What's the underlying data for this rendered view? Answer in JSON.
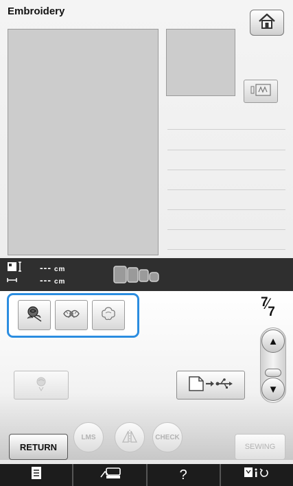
{
  "header": {
    "title": "Embroidery",
    "home_icon": "home-icon"
  },
  "preview": {
    "thumb_mode_icon": "thumbnail-toggle-icon"
  },
  "dimensions": {
    "height_value": "---",
    "height_unit": "cm",
    "width_value": "---",
    "width_unit": "cm",
    "size_icon": "pattern-size-icon",
    "hoop_icon": "embroidery-frame-icon"
  },
  "patterns": {
    "items": [
      {
        "icon": "rose-pattern-icon"
      },
      {
        "icon": "leaf-flower-pattern-icon"
      },
      {
        "icon": "flower-outline-pattern-icon"
      }
    ]
  },
  "pager": {
    "current": "7",
    "total": "7",
    "up_label": "▲",
    "down_label": "▼"
  },
  "actions": {
    "usb_icon": "usb-transfer-icon",
    "preview_icon": "pattern-preview-icon"
  },
  "footer": {
    "return_label": "RETURN",
    "lms_label": "LMS",
    "check_label": "CHECK",
    "sewing_label": "SEWING",
    "mirror_icon": "mirror-icon"
  },
  "bottom_bar": {
    "help_label": "?",
    "items": [
      "document-icon",
      "sewing-machine-icon",
      "help-icon",
      "settings-icon"
    ]
  },
  "colors": {
    "highlight": "#2b8de0",
    "dark_bar": "#2f2f2f",
    "preview_bg": "#cccccc"
  }
}
